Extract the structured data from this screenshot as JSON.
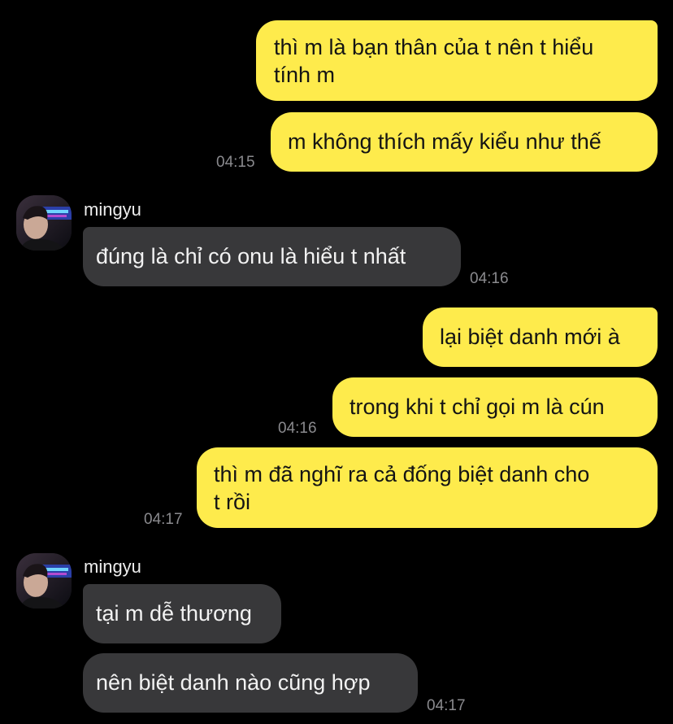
{
  "conversation": {
    "msg_1": "thì m là bạn thân của t nên t hiểu\ntính m",
    "msg_2": "m không thích mấy kiểu như thế",
    "time_1": "04:15",
    "sender_1": "mingyu",
    "msg_3": "đúng là chỉ có onu là hiểu t nhất",
    "time_2": "04:16",
    "msg_4": "lại biệt danh mới à",
    "msg_5": "trong khi t chỉ gọi m là cún",
    "time_3": "04:16",
    "msg_6": "thì m đã nghĩ ra cả đống biệt danh cho\nt rồi",
    "time_4": "04:17",
    "sender_2": "mingyu",
    "msg_7": "tại m dễ thương",
    "msg_8": "nên biệt danh nào cũng hợp",
    "time_5": "04:17"
  },
  "colors": {
    "background": "#000000",
    "outgoing_bubble": "#FEEB4C",
    "incoming_bubble": "#38383A",
    "timestamp": "#8A8A8E"
  },
  "icons": {
    "avatar": "profile-photo-avatar"
  }
}
